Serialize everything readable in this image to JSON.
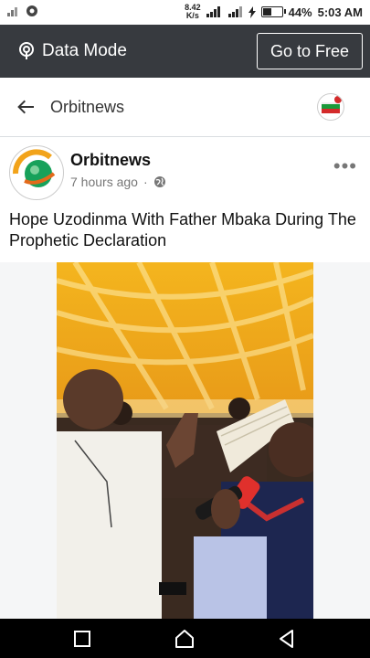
{
  "status_bar": {
    "speed_value": "8.42",
    "speed_unit": "K/s",
    "battery_level": 0.44,
    "battery": "44%",
    "time": "5:03 AM"
  },
  "banner": {
    "mode_label": "Data Mode",
    "go_free_label": "Go to Free"
  },
  "header": {
    "title": "Orbitnews"
  },
  "post": {
    "author": "Orbitnews",
    "time_ago": "7 hours ago",
    "dot": "·",
    "caption": "Hope Uzodinma With Father Mbaka During The Prophetic Declaration"
  },
  "colors": {
    "banner_bg": "#373a3f",
    "canopy": "#f2b21c",
    "nav_bar": "#000000"
  },
  "icons": [
    "signal-icon",
    "data-mode-icon",
    "back-arrow-icon",
    "globe-icon",
    "more-icon",
    "square-icon",
    "home-icon",
    "back-triangle-icon"
  ]
}
